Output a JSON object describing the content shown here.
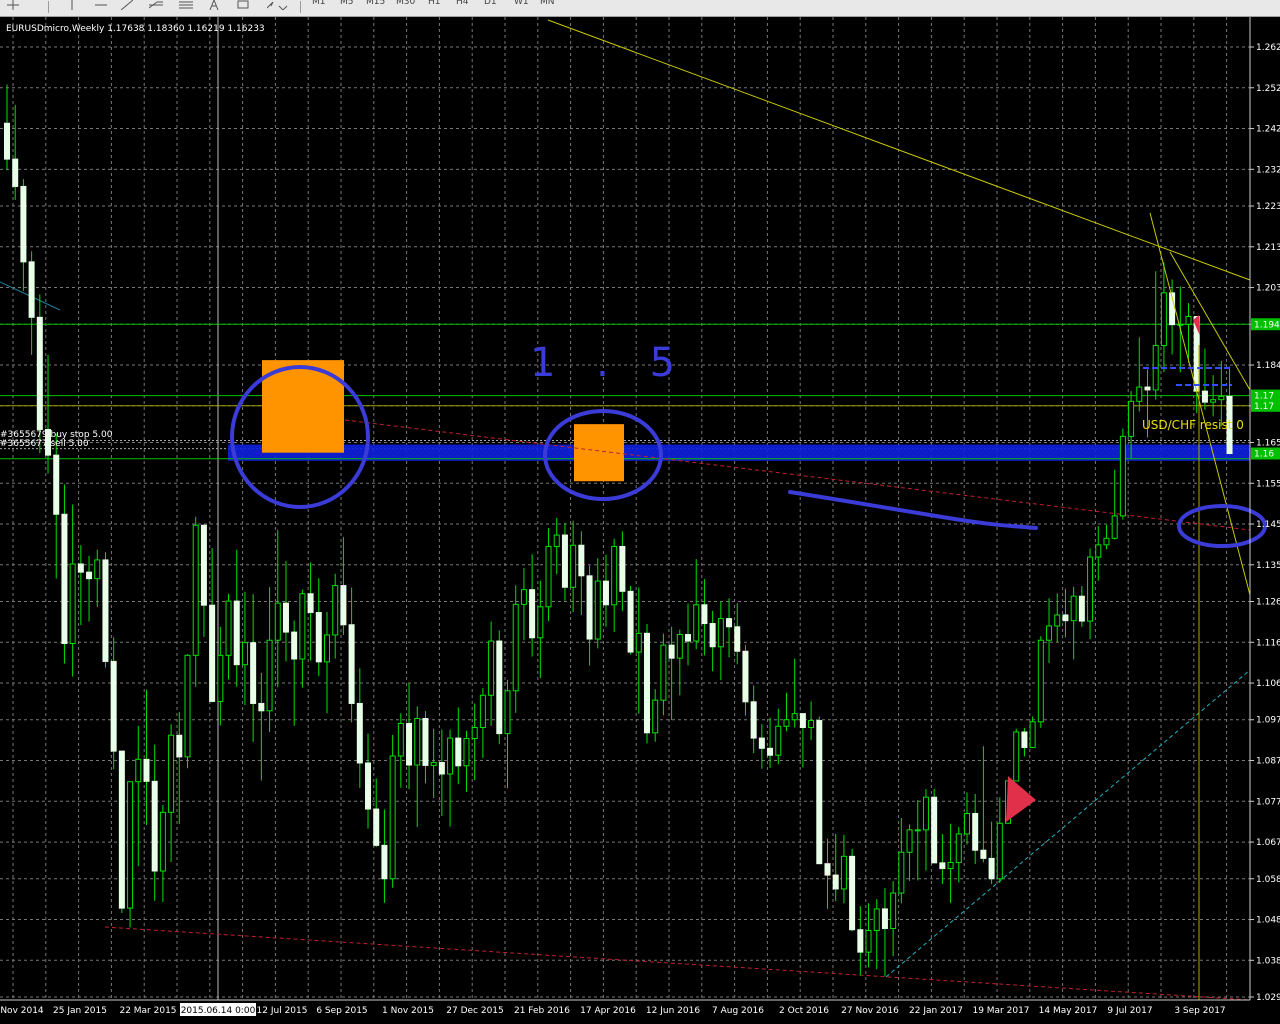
{
  "toolbar": {
    "icons": [
      "crosshair-icon",
      "vertical-line-icon",
      "horizontal-line-icon",
      "trendline-icon",
      "fibo-icon",
      "channel-icon",
      "text-icon",
      "arrows-icon"
    ],
    "timeframes": [
      "M1",
      "M5",
      "M15",
      "M30",
      "H1",
      "H4",
      "D1",
      "W1",
      "MN"
    ]
  },
  "symbol_info": "EURUSDmicro,Weekly  1.17638 1.18360 1.16219 1.16233",
  "orders": [
    "#3655679  buy stop 5.00",
    "#3655677  sell 5.00"
  ],
  "indicator_label": "USD/CHF resist 0",
  "handwriting": "1 . 5",
  "colors": {
    "background": "#000000",
    "grid": "#777777",
    "candle": "#00e000",
    "axis_text": "#ffffff",
    "hline": "#00c000",
    "trend": "#c8c800",
    "zone": "#1020e0",
    "rect": "#ff9400",
    "marker": "#e0304a",
    "handwriting": "#3b3bd8",
    "dotted_red": "#c02030",
    "dotted_cyan": "#20b0c0"
  },
  "chart_data": {
    "type": "candlestick",
    "symbol": "EURUSDmicro",
    "period": "Weekly",
    "ylim": [
      1.029,
      1.262
    ],
    "y_ticks": [
      "1.262",
      "1.252",
      "1.242",
      "1.232",
      "1.223",
      "1.213",
      "1.203",
      "1.194",
      "1.184",
      "1.174",
      "1.165",
      "1.155",
      "1.145",
      "1.135",
      "1.126",
      "1.116",
      "1.106",
      "1.097",
      "1.087",
      "1.077",
      "1.067",
      "1.058",
      "1.048",
      "1.038",
      "1.029"
    ],
    "price_tags": [
      {
        "label": "1.194",
        "value": 1.194,
        "color": "#00c000"
      },
      {
        "label": "1.17",
        "value": 1.1765,
        "color": "#00c000"
      },
      {
        "label": "1.17",
        "value": 1.174,
        "color": "#00c000"
      },
      {
        "label": "1.16",
        "value": 1.1623,
        "color": "#00c000"
      }
    ],
    "x_labels": [
      "Nov 2014",
      "25 Jan 2015",
      "22 Mar 2015",
      "2015.06.14 0:00",
      "12 Jul 2015",
      "6 Sep 2015",
      "1 Nov 2015",
      "27 Dec 2015",
      "21 Feb 2016",
      "17 Apr 2016",
      "12 Jun 2016",
      "7 Aug 2016",
      "2 Oct 2016",
      "27 Nov 2016",
      "22 Jan 2017",
      "19 Mar 2017",
      "14 May 2017",
      "9 Jul 2017",
      "3 Sep 2017"
    ],
    "highlight_x_label": "2015.06.14 0:00",
    "candles": [
      [
        1.2433,
        1.2528,
        1.2318,
        1.2345
      ],
      [
        1.2345,
        1.2478,
        1.2245,
        1.2278
      ],
      [
        1.2278,
        1.2296,
        1.2022,
        1.2093
      ],
      [
        1.2093,
        1.2119,
        1.1865,
        1.1957
      ],
      [
        1.1957,
        1.2013,
        1.1624,
        1.1682
      ],
      [
        1.1682,
        1.1865,
        1.1574,
        1.1619
      ],
      [
        1.1619,
        1.1672,
        1.1316,
        1.1474
      ],
      [
        1.1474,
        1.1547,
        1.1108,
        1.1157
      ],
      [
        1.1157,
        1.1498,
        1.1076,
        1.1352
      ],
      [
        1.1352,
        1.1398,
        1.1202,
        1.1332
      ],
      [
        1.1332,
        1.1372,
        1.1211,
        1.1316
      ],
      [
        1.1316,
        1.1387,
        1.1247,
        1.1362
      ],
      [
        1.1362,
        1.1381,
        1.1098,
        1.1113
      ],
      [
        1.1113,
        1.1172,
        1.0849,
        1.0893
      ],
      [
        1.0893,
        1.0892,
        1.0496,
        1.0508
      ],
      [
        1.0508,
        1.0684,
        1.0461,
        1.0818
      ],
      [
        1.0818,
        1.0955,
        1.0611,
        1.0873
      ],
      [
        1.0873,
        1.1044,
        1.0712,
        1.0819
      ],
      [
        1.0819,
        1.0909,
        1.0526,
        1.0599
      ],
      [
        1.0599,
        1.0761,
        1.0523,
        1.0743
      ],
      [
        1.0743,
        1.0959,
        1.0621,
        1.0932
      ],
      [
        1.0932,
        1.0989,
        1.0714,
        1.0879
      ],
      [
        1.0879,
        1.1131,
        1.0851,
        1.1128
      ],
      [
        1.1128,
        1.1468,
        1.1051,
        1.1447
      ],
      [
        1.1447,
        1.1449,
        1.1173,
        1.1251
      ],
      [
        1.1251,
        1.1391,
        1.1013,
        1.1015
      ],
      [
        1.1015,
        1.1198,
        1.0956,
        1.1128
      ],
      [
        1.1128,
        1.1279,
        1.1069,
        1.1261
      ],
      [
        1.1261,
        1.1387,
        1.1051,
        1.1105
      ],
      [
        1.1105,
        1.1284,
        1.1006,
        1.1159
      ],
      [
        1.1159,
        1.1278,
        1.0915,
        1.101
      ],
      [
        1.101,
        1.1085,
        1.0821,
        1.0992
      ],
      [
        1.0992,
        1.1295,
        1.094,
        1.1165
      ],
      [
        1.1165,
        1.1436,
        1.105,
        1.1256
      ],
      [
        1.1256,
        1.1359,
        1.1113,
        1.1185
      ],
      [
        1.1185,
        1.1213,
        1.0955,
        1.1119
      ],
      [
        1.1119,
        1.1289,
        1.1049,
        1.1279
      ],
      [
        1.1279,
        1.1356,
        1.1115,
        1.1233
      ],
      [
        1.1233,
        1.1317,
        1.1077,
        1.1112
      ],
      [
        1.1112,
        1.1234,
        1.0986,
        1.1178
      ],
      [
        1.1178,
        1.1328,
        1.112,
        1.1299
      ],
      [
        1.1299,
        1.1418,
        1.1178,
        1.1203
      ],
      [
        1.1203,
        1.1294,
        1.0964,
        1.101
      ],
      [
        1.101,
        1.1096,
        1.0803,
        1.0864
      ],
      [
        1.0864,
        1.0936,
        1.0703,
        1.0751
      ],
      [
        1.0751,
        1.0826,
        1.0658,
        1.0662
      ],
      [
        1.0662,
        1.075,
        1.0521,
        1.058
      ],
      [
        1.058,
        1.0933,
        1.0558,
        1.0881
      ],
      [
        1.0881,
        1.0986,
        1.0803,
        1.0961
      ],
      [
        1.0961,
        1.106,
        1.08,
        1.0859
      ],
      [
        1.0859,
        1.1003,
        1.0707,
        1.0973
      ],
      [
        1.0973,
        1.0991,
        1.0814,
        1.0858
      ],
      [
        1.0858,
        1.0948,
        1.0778,
        1.0865
      ],
      [
        1.0865,
        1.0946,
        1.0734,
        1.0837
      ],
      [
        1.0837,
        1.0946,
        1.0708,
        1.0925
      ],
      [
        1.0925,
        1.1,
        1.0812,
        1.0857
      ],
      [
        1.0857,
        1.0943,
        1.0793,
        1.0924
      ],
      [
        1.0924,
        1.101,
        1.0822,
        1.0951
      ],
      [
        1.0951,
        1.1048,
        1.0876,
        1.103
      ],
      [
        1.103,
        1.1211,
        1.0955,
        1.1163
      ],
      [
        1.1163,
        1.1189,
        1.091,
        1.0936
      ],
      [
        1.0936,
        1.1068,
        1.0802,
        1.1041
      ],
      [
        1.1041,
        1.13,
        1.0987,
        1.1253
      ],
      [
        1.1253,
        1.1342,
        1.1165,
        1.1289
      ],
      [
        1.1289,
        1.1376,
        1.1125,
        1.1171
      ],
      [
        1.1171,
        1.1311,
        1.1072,
        1.1247
      ],
      [
        1.1247,
        1.144,
        1.1212,
        1.1395
      ],
      [
        1.1395,
        1.1465,
        1.1327,
        1.1423
      ],
      [
        1.1423,
        1.1453,
        1.1262,
        1.1295
      ],
      [
        1.1295,
        1.1458,
        1.1234,
        1.1398
      ],
      [
        1.1398,
        1.1432,
        1.1227,
        1.1323
      ],
      [
        1.1323,
        1.1348,
        1.1103,
        1.1168
      ],
      [
        1.1168,
        1.1366,
        1.1145,
        1.131
      ],
      [
        1.131,
        1.1375,
        1.1198,
        1.1252
      ],
      [
        1.1252,
        1.1414,
        1.1185,
        1.1395
      ],
      [
        1.1395,
        1.1432,
        1.1237,
        1.1285
      ],
      [
        1.1285,
        1.1298,
        1.113,
        1.1136
      ],
      [
        1.1136,
        1.1294,
        1.0985,
        1.1182
      ],
      [
        1.1182,
        1.1205,
        1.0912,
        1.0938
      ],
      [
        1.0938,
        1.1045,
        1.0916,
        1.1018
      ],
      [
        1.1018,
        1.1181,
        1.0981,
        1.1153
      ],
      [
        1.1153,
        1.1198,
        1.0969,
        1.1121
      ],
      [
        1.1121,
        1.1191,
        1.103,
        1.1179
      ],
      [
        1.1179,
        1.1255,
        1.1103,
        1.1163
      ],
      [
        1.1163,
        1.1364,
        1.1143,
        1.1252
      ],
      [
        1.1252,
        1.1315,
        1.1128,
        1.1206
      ],
      [
        1.1206,
        1.1237,
        1.1089,
        1.1149
      ],
      [
        1.1149,
        1.126,
        1.1067,
        1.1218
      ],
      [
        1.1218,
        1.1268,
        1.1123,
        1.1198
      ],
      [
        1.1198,
        1.1256,
        1.1106,
        1.1138
      ],
      [
        1.1138,
        1.1153,
        1.098,
        1.1014
      ],
      [
        1.1014,
        1.1054,
        1.0888,
        1.0925
      ],
      [
        1.0925,
        1.0959,
        1.085,
        1.09
      ],
      [
        1.09,
        1.0975,
        1.0852,
        1.0883
      ],
      [
        1.0883,
        1.0997,
        1.0861,
        1.0954
      ],
      [
        1.0954,
        1.1036,
        1.0942,
        1.097
      ],
      [
        1.097,
        1.112,
        1.0951,
        1.0985
      ],
      [
        1.0985,
        1.0971,
        1.0853,
        1.0951
      ],
      [
        1.0951,
        1.1015,
        1.092,
        1.0968
      ],
      [
        1.0968,
        1.0978,
        1.0617,
        1.0617
      ],
      [
        1.0617,
        1.0678,
        1.0506,
        1.0589
      ],
      [
        1.0589,
        1.069,
        1.0525,
        1.0555
      ],
      [
        1.0555,
        1.0688,
        1.052,
        1.0635
      ],
      [
        1.0635,
        1.0653,
        1.0451,
        1.0455
      ],
      [
        1.0455,
        1.0513,
        1.0343,
        1.04
      ],
      [
        1.04,
        1.052,
        1.0363,
        1.0453
      ],
      [
        1.0453,
        1.053,
        1.0358,
        1.0506
      ],
      [
        1.0506,
        1.0557,
        1.0341,
        1.0458
      ],
      [
        1.0458,
        1.0574,
        1.039,
        1.0545
      ],
      [
        1.0545,
        1.0729,
        1.052,
        1.0645
      ],
      [
        1.0645,
        1.0713,
        1.0575,
        1.07
      ],
      [
        1.07,
        1.0773,
        1.0576,
        1.07
      ],
      [
        1.07,
        1.08,
        1.06,
        1.078
      ],
      [
        1.078,
        1.08,
        1.0619,
        1.0619
      ],
      [
        1.0619,
        1.069,
        1.0567,
        1.0605
      ],
      [
        1.0605,
        1.0715,
        1.0521,
        1.062
      ],
      [
        1.062,
        1.0707,
        1.0571,
        1.069
      ],
      [
        1.069,
        1.0792,
        1.0664,
        1.074
      ],
      [
        1.074,
        1.0788,
        1.0616,
        1.065
      ],
      [
        1.065,
        1.0905,
        1.062,
        1.063
      ],
      [
        1.063,
        1.072,
        1.0567,
        1.058
      ],
      [
        1.058,
        1.078,
        1.057,
        1.0716
      ],
      [
        1.0716,
        1.0797,
        1.082,
        1.082
      ],
      [
        1.082,
        1.0948,
        1.084,
        1.094
      ],
      [
        1.094,
        1.095,
        1.088,
        1.0902
      ],
      [
        1.0902,
        1.0978,
        1.0945,
        1.0965
      ],
      [
        1.0965,
        1.1175,
        1.095,
        1.1165
      ],
      [
        1.1165,
        1.1268,
        1.1109,
        1.12
      ],
      [
        1.12,
        1.128,
        1.116,
        1.1227
      ],
      [
        1.1227,
        1.1291,
        1.1172,
        1.1213
      ],
      [
        1.1213,
        1.1296,
        1.1118,
        1.1273
      ],
      [
        1.1273,
        1.1298,
        1.1198,
        1.1212
      ],
      [
        1.1212,
        1.139,
        1.1168,
        1.1369
      ],
      [
        1.1369,
        1.1445,
        1.1311,
        1.1399
      ],
      [
        1.1399,
        1.1448,
        1.1388,
        1.1415
      ],
      [
        1.1415,
        1.1583,
        1.1412,
        1.147
      ],
      [
        1.147,
        1.1684,
        1.1461,
        1.1665
      ],
      [
        1.1665,
        1.1776,
        1.1612,
        1.1751
      ],
      [
        1.1751,
        1.1908,
        1.1726,
        1.1786
      ],
      [
        1.1786,
        1.1829,
        1.1662,
        1.1779
      ],
      [
        1.1779,
        1.207,
        1.1755,
        1.1888
      ],
      [
        1.1888,
        1.2092,
        1.1823,
        1.2017
      ],
      [
        1.2017,
        1.205,
        1.1866,
        1.1939
      ],
      [
        1.1939,
        1.2033,
        1.1822,
        1.194
      ],
      [
        1.194,
        1.1992,
        1.1846,
        1.1959
      ],
      [
        1.1959,
        1.1925,
        1.1722,
        1.1776
      ],
      [
        1.1776,
        1.188,
        1.173,
        1.1749
      ],
      [
        1.1749,
        1.1815,
        1.1714,
        1.1755
      ],
      [
        1.1755,
        1.185,
        1.169,
        1.1763
      ],
      [
        1.1763,
        1.1836,
        1.1621,
        1.1623
      ]
    ]
  }
}
